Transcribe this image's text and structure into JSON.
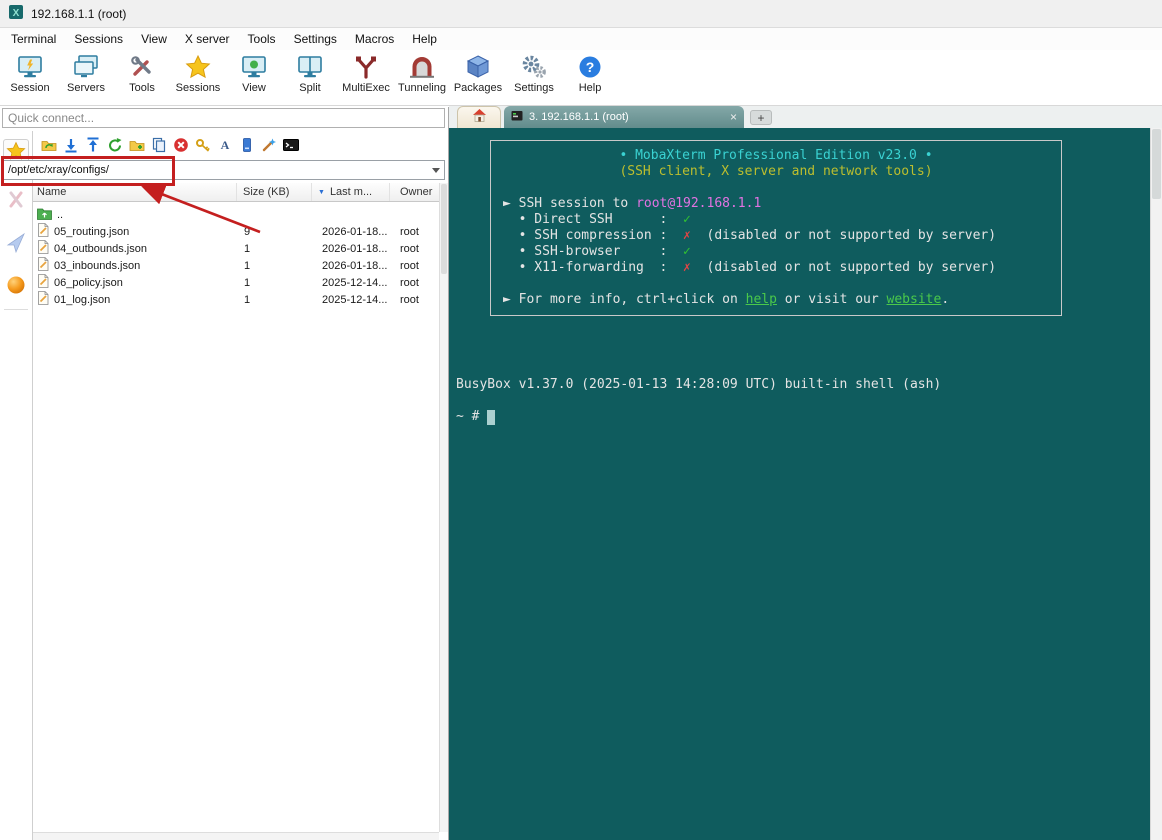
{
  "window": {
    "title": "192.168.1.1 (root)"
  },
  "menubar": {
    "items": [
      "Terminal",
      "Sessions",
      "View",
      "X server",
      "Tools",
      "Settings",
      "Macros",
      "Help"
    ]
  },
  "toolbar": {
    "items": [
      "Session",
      "Servers",
      "Tools",
      "Sessions",
      "View",
      "Split",
      "MultiExec",
      "Tunneling",
      "Packages",
      "Settings",
      "Help"
    ]
  },
  "quick_connect": {
    "placeholder": "Quick connect..."
  },
  "sftp": {
    "path": "/opt/etc/xray/configs/",
    "sort_glyph": "▼",
    "columns": {
      "name": "Name",
      "size": "Size (KB)",
      "last": "Last m...",
      "owner": "Owner"
    },
    "parent": {
      "name": ".."
    },
    "files": [
      {
        "name": "05_routing.json",
        "size": "9",
        "last": "2026-01-18...",
        "owner": "root"
      },
      {
        "name": "04_outbounds.json",
        "size": "1",
        "last": "2026-01-18...",
        "owner": "root"
      },
      {
        "name": "03_inbounds.json",
        "size": "1",
        "last": "2026-01-18...",
        "owner": "root"
      },
      {
        "name": "06_policy.json",
        "size": "1",
        "last": "2025-12-14...",
        "owner": "root"
      },
      {
        "name": "01_log.json",
        "size": "1",
        "last": "2025-12-14...",
        "owner": "root"
      }
    ]
  },
  "tabs": {
    "active_label": "3. 192.168.1.1 (root)",
    "close_glyph": "×",
    "new_glyph": "+"
  },
  "terminal": {
    "banner": {
      "title": "• MobaXterm Professional Edition v23.0 •",
      "subtitle": "(SSH client, X server and network tools)",
      "session_prefix": "► SSH session to ",
      "session_target": "root@192.168.1.1",
      "direct_label": "  • Direct SSH      :  ",
      "compression_label": "  • SSH compression :  ",
      "browser_label": "  • SSH-browser     :  ",
      "x11_label": "  • X11-forwarding  :  ",
      "check_mark": "✓",
      "cross_mark": "✗",
      "disabled_note": "  (disabled or not supported by server)",
      "info_prefix": "► For more info, ctrl+click on ",
      "help_label": "help",
      "info_middle": " or visit our ",
      "website_label": "website",
      "info_suffix": "."
    },
    "busybox": "BusyBox v1.37.0 (2025-01-13 14:28:09 UTC) built-in shell (ash)",
    "prompt": "~ # "
  },
  "colors": {
    "terminal_background": "#0f5c5e",
    "banner_cyan": "#3ad2d2",
    "banner_yellow": "#bcbe2e",
    "session_magenta": "#e273e2",
    "enabled_green": "#31c231",
    "disabled_red": "#e04545",
    "link_green": "#4ac94a",
    "annotation_red": "#c41f1f"
  }
}
